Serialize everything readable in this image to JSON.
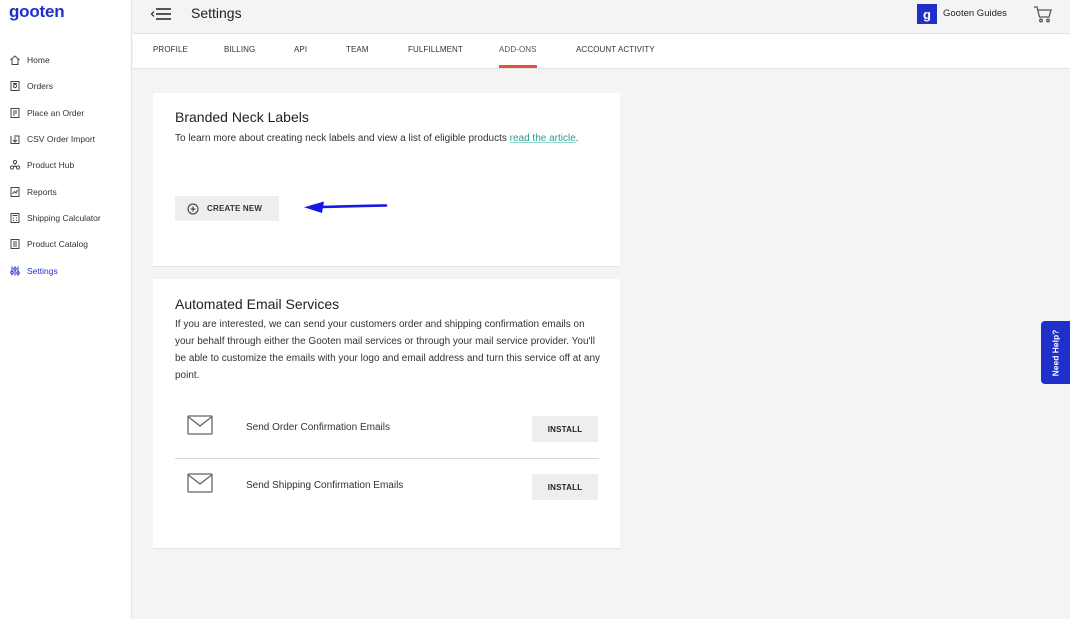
{
  "brand": {
    "logo_text": "gooten",
    "accent_color": "#1f2fc9",
    "tab_indicator_color": "#e4543c",
    "link_color": "#2a9d8f"
  },
  "sidebar": {
    "items": [
      {
        "label": "Home",
        "icon": "home-icon"
      },
      {
        "label": "Orders",
        "icon": "orders-icon"
      },
      {
        "label": "Place an Order",
        "icon": "place-order-icon"
      },
      {
        "label": "CSV Order Import",
        "icon": "csv-import-icon"
      },
      {
        "label": "Product Hub",
        "icon": "product-hub-icon"
      },
      {
        "label": "Reports",
        "icon": "reports-icon"
      },
      {
        "label": "Shipping Calculator",
        "icon": "calculator-icon"
      },
      {
        "label": "Product Catalog",
        "icon": "catalog-icon"
      },
      {
        "label": "Settings",
        "icon": "settings-icon",
        "active": true
      }
    ]
  },
  "header": {
    "title": "Settings",
    "guides_badge": "g",
    "guides_label": "Gooten Guides"
  },
  "tabs": [
    {
      "label": "PROFILE"
    },
    {
      "label": "BILLING"
    },
    {
      "label": "API"
    },
    {
      "label": "TEAM"
    },
    {
      "label": "FULFILLMENT"
    },
    {
      "label": "ADD-ONS",
      "active": true
    },
    {
      "label": "ACCOUNT ACTIVITY"
    }
  ],
  "neck_labels": {
    "title": "Branded Neck Labels",
    "desc_text": "To learn more about creating neck labels and view a list of eligible products ",
    "desc_link": "read the article",
    "desc_end": ".",
    "create_label": "CREATE NEW"
  },
  "email_services": {
    "title": "Automated Email Services",
    "description": "If you are interested, we can send your customers order and shipping confirmation emails on your behalf through either the Gooten mail services or through your mail service provider. You'll be able to customize the emails with your logo and email address and turn this service off at any point.",
    "rows": [
      {
        "label": "Send Order Confirmation Emails",
        "button": "INSTALL"
      },
      {
        "label": "Send Shipping Confirmation Emails",
        "button": "INSTALL"
      }
    ]
  },
  "help": {
    "label": "Need Help?"
  }
}
